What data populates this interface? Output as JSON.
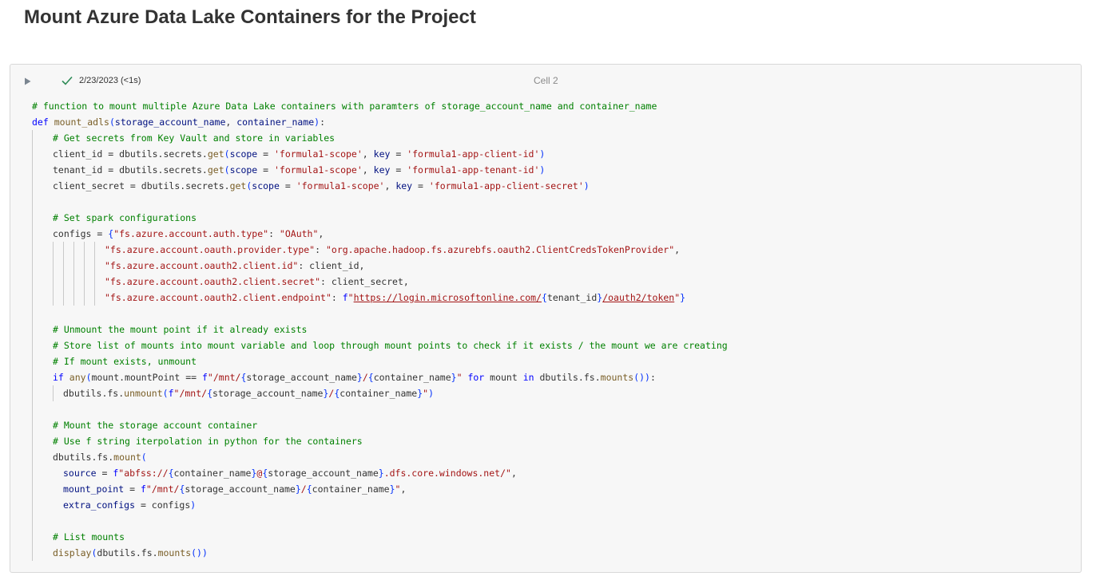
{
  "page": {
    "heading": "Mount Azure Data Lake Containers for the Project"
  },
  "cell": {
    "timestamp": "2/23/2023 (<1s)",
    "label": "Cell 2",
    "status_icon": "check-icon",
    "run_icon": "play-icon"
  },
  "code": {
    "lines": [
      {
        "ind": 0,
        "tokens": [
          {
            "c": "cm",
            "t": "# function to mount multiple Azure Data Lake containers with paramters of storage_account_name and container_name"
          }
        ]
      },
      {
        "ind": 0,
        "tokens": [
          {
            "c": "kw",
            "t": "def "
          },
          {
            "c": "fn",
            "t": "mount_adls"
          },
          {
            "c": "br",
            "t": "("
          },
          {
            "c": "pm",
            "t": "storage_account_name"
          },
          {
            "c": "",
            "t": ", "
          },
          {
            "c": "pm",
            "t": "container_name"
          },
          {
            "c": "br",
            "t": ")"
          },
          {
            "c": "",
            "t": ":"
          }
        ]
      },
      {
        "ind": 1,
        "tokens": [
          {
            "c": "cm",
            "t": "# Get secrets from Key Vault and store in variables"
          }
        ]
      },
      {
        "ind": 1,
        "tokens": [
          {
            "c": "",
            "t": "client_id = dbutils.secrets."
          },
          {
            "c": "fn",
            "t": "get"
          },
          {
            "c": "br",
            "t": "("
          },
          {
            "c": "pm",
            "t": "scope"
          },
          {
            "c": "",
            "t": " = "
          },
          {
            "c": "st",
            "t": "'formula1-scope'"
          },
          {
            "c": "",
            "t": ", "
          },
          {
            "c": "pm",
            "t": "key"
          },
          {
            "c": "",
            "t": " = "
          },
          {
            "c": "st",
            "t": "'formula1-app-client-id'"
          },
          {
            "c": "br",
            "t": ")"
          }
        ]
      },
      {
        "ind": 1,
        "tokens": [
          {
            "c": "",
            "t": "tenant_id = dbutils.secrets."
          },
          {
            "c": "fn",
            "t": "get"
          },
          {
            "c": "br",
            "t": "("
          },
          {
            "c": "pm",
            "t": "scope"
          },
          {
            "c": "",
            "t": " = "
          },
          {
            "c": "st",
            "t": "'formula1-scope'"
          },
          {
            "c": "",
            "t": ", "
          },
          {
            "c": "pm",
            "t": "key"
          },
          {
            "c": "",
            "t": " = "
          },
          {
            "c": "st",
            "t": "'formula1-app-tenant-id'"
          },
          {
            "c": "br",
            "t": ")"
          }
        ]
      },
      {
        "ind": 1,
        "tokens": [
          {
            "c": "",
            "t": "client_secret = dbutils.secrets."
          },
          {
            "c": "fn",
            "t": "get"
          },
          {
            "c": "br",
            "t": "("
          },
          {
            "c": "pm",
            "t": "scope"
          },
          {
            "c": "",
            "t": " = "
          },
          {
            "c": "st",
            "t": "'formula1-scope'"
          },
          {
            "c": "",
            "t": ", "
          },
          {
            "c": "pm",
            "t": "key"
          },
          {
            "c": "",
            "t": " = "
          },
          {
            "c": "st",
            "t": "'formula1-app-client-secret'"
          },
          {
            "c": "br",
            "t": ")"
          }
        ]
      },
      {
        "ind": 1,
        "tokens": []
      },
      {
        "ind": 1,
        "tokens": [
          {
            "c": "cm",
            "t": "# Set spark configurations"
          }
        ]
      },
      {
        "ind": 1,
        "tokens": [
          {
            "c": "",
            "t": "configs = "
          },
          {
            "c": "br",
            "t": "{"
          },
          {
            "c": "st",
            "t": "\"fs.azure.account.auth.type\""
          },
          {
            "c": "",
            "t": ": "
          },
          {
            "c": "st",
            "t": "\"OAuth\""
          },
          {
            "c": "",
            "t": ","
          }
        ]
      },
      {
        "ind": 6,
        "tokens": [
          {
            "c": "st",
            "t": "\"fs.azure.account.oauth.provider.type\""
          },
          {
            "c": "",
            "t": ": "
          },
          {
            "c": "st",
            "t": "\"org.apache.hadoop.fs.azurebfs.oauth2.ClientCredsTokenProvider\""
          },
          {
            "c": "",
            "t": ","
          }
        ]
      },
      {
        "ind": 6,
        "tokens": [
          {
            "c": "st",
            "t": "\"fs.azure.account.oauth2.client.id\""
          },
          {
            "c": "",
            "t": ": client_id,"
          }
        ]
      },
      {
        "ind": 6,
        "tokens": [
          {
            "c": "st",
            "t": "\"fs.azure.account.oauth2.client.secret\""
          },
          {
            "c": "",
            "t": ": client_secret,"
          }
        ]
      },
      {
        "ind": 6,
        "tokens": [
          {
            "c": "st",
            "t": "\"fs.azure.account.oauth2.client.endpoint\""
          },
          {
            "c": "",
            "t": ": "
          },
          {
            "c": "kw",
            "t": "f"
          },
          {
            "c": "st",
            "t": "\""
          },
          {
            "c": "url",
            "t": "https://login.microsoftonline.com/"
          },
          {
            "c": "br",
            "t": "{"
          },
          {
            "c": "",
            "t": "tenant_id"
          },
          {
            "c": "br",
            "t": "}"
          },
          {
            "c": "url",
            "t": "/oauth2/token"
          },
          {
            "c": "st",
            "t": "\""
          },
          {
            "c": "br",
            "t": "}"
          }
        ]
      },
      {
        "ind": 1,
        "tokens": []
      },
      {
        "ind": 1,
        "tokens": [
          {
            "c": "cm",
            "t": "# Unmount the mount point if it already exists"
          }
        ]
      },
      {
        "ind": 1,
        "tokens": [
          {
            "c": "cm",
            "t": "# Store list of mounts into mount variable and loop through mount points to check if it exists / the mount we are creating"
          }
        ]
      },
      {
        "ind": 1,
        "tokens": [
          {
            "c": "cm",
            "t": "# If mount exists, unmount"
          }
        ]
      },
      {
        "ind": 1,
        "tokens": [
          {
            "c": "kw",
            "t": "if "
          },
          {
            "c": "fn",
            "t": "any"
          },
          {
            "c": "br",
            "t": "("
          },
          {
            "c": "",
            "t": "mount.mountPoint == "
          },
          {
            "c": "kw",
            "t": "f"
          },
          {
            "c": "st",
            "t": "\"/mnt/"
          },
          {
            "c": "br",
            "t": "{"
          },
          {
            "c": "",
            "t": "storage_account_name"
          },
          {
            "c": "br",
            "t": "}"
          },
          {
            "c": "st",
            "t": "/"
          },
          {
            "c": "br",
            "t": "{"
          },
          {
            "c": "",
            "t": "container_name"
          },
          {
            "c": "br",
            "t": "}"
          },
          {
            "c": "st",
            "t": "\""
          },
          {
            "c": "kw",
            "t": " for "
          },
          {
            "c": "",
            "t": "mount "
          },
          {
            "c": "kw",
            "t": "in "
          },
          {
            "c": "",
            "t": "dbutils.fs."
          },
          {
            "c": "fn",
            "t": "mounts"
          },
          {
            "c": "br",
            "t": "())"
          },
          {
            "c": "",
            "t": ":"
          }
        ]
      },
      {
        "ind": 2,
        "tokens": [
          {
            "c": "",
            "t": "dbutils.fs."
          },
          {
            "c": "fn",
            "t": "unmount"
          },
          {
            "c": "br",
            "t": "("
          },
          {
            "c": "kw",
            "t": "f"
          },
          {
            "c": "st",
            "t": "\"/mnt/"
          },
          {
            "c": "br",
            "t": "{"
          },
          {
            "c": "",
            "t": "storage_account_name"
          },
          {
            "c": "br",
            "t": "}"
          },
          {
            "c": "st",
            "t": "/"
          },
          {
            "c": "br",
            "t": "{"
          },
          {
            "c": "",
            "t": "container_name"
          },
          {
            "c": "br",
            "t": "}"
          },
          {
            "c": "st",
            "t": "\""
          },
          {
            "c": "br",
            "t": ")"
          }
        ]
      },
      {
        "ind": 1,
        "tokens": []
      },
      {
        "ind": 1,
        "tokens": [
          {
            "c": "cm",
            "t": "# Mount the storage account container"
          }
        ]
      },
      {
        "ind": 1,
        "tokens": [
          {
            "c": "cm",
            "t": "# Use f string iterpolation in python for the containers"
          }
        ]
      },
      {
        "ind": 1,
        "tokens": [
          {
            "c": "",
            "t": "dbutils.fs."
          },
          {
            "c": "fn",
            "t": "mount"
          },
          {
            "c": "br",
            "t": "("
          }
        ]
      },
      {
        "ind": 1,
        "pad": 1,
        "tokens": [
          {
            "c": "pm",
            "t": "source"
          },
          {
            "c": "",
            "t": " = "
          },
          {
            "c": "kw",
            "t": "f"
          },
          {
            "c": "st",
            "t": "\"abfss://"
          },
          {
            "c": "br",
            "t": "{"
          },
          {
            "c": "",
            "t": "container_name"
          },
          {
            "c": "br",
            "t": "}"
          },
          {
            "c": "st",
            "t": "@"
          },
          {
            "c": "br",
            "t": "{"
          },
          {
            "c": "",
            "t": "storage_account_name"
          },
          {
            "c": "br",
            "t": "}"
          },
          {
            "c": "st",
            "t": ".dfs.core.windows.net/\""
          },
          {
            "c": "",
            "t": ","
          }
        ]
      },
      {
        "ind": 1,
        "pad": 1,
        "tokens": [
          {
            "c": "pm",
            "t": "mount_point"
          },
          {
            "c": "",
            "t": " = "
          },
          {
            "c": "kw",
            "t": "f"
          },
          {
            "c": "st",
            "t": "\"/mnt/"
          },
          {
            "c": "br",
            "t": "{"
          },
          {
            "c": "",
            "t": "storage_account_name"
          },
          {
            "c": "br",
            "t": "}"
          },
          {
            "c": "st",
            "t": "/"
          },
          {
            "c": "br",
            "t": "{"
          },
          {
            "c": "",
            "t": "container_name"
          },
          {
            "c": "br",
            "t": "}"
          },
          {
            "c": "st",
            "t": "\""
          },
          {
            "c": "",
            "t": ","
          }
        ]
      },
      {
        "ind": 1,
        "pad": 1,
        "tokens": [
          {
            "c": "pm",
            "t": "extra_configs"
          },
          {
            "c": "",
            "t": " = configs"
          },
          {
            "c": "br",
            "t": ")"
          }
        ]
      },
      {
        "ind": 1,
        "tokens": []
      },
      {
        "ind": 1,
        "tokens": [
          {
            "c": "cm",
            "t": "# List mounts"
          }
        ]
      },
      {
        "ind": 1,
        "tokens": [
          {
            "c": "fn",
            "t": "display"
          },
          {
            "c": "br",
            "t": "("
          },
          {
            "c": "",
            "t": "dbutils.fs."
          },
          {
            "c": "fn",
            "t": "mounts"
          },
          {
            "c": "br",
            "t": "())"
          }
        ]
      }
    ]
  },
  "colors": {
    "comment": "#008000",
    "keyword": "#0000ff",
    "string": "#a31515",
    "function": "#795e26",
    "parameter": "#001080",
    "bracket": "#0431fa",
    "check": "#2e8b57"
  }
}
